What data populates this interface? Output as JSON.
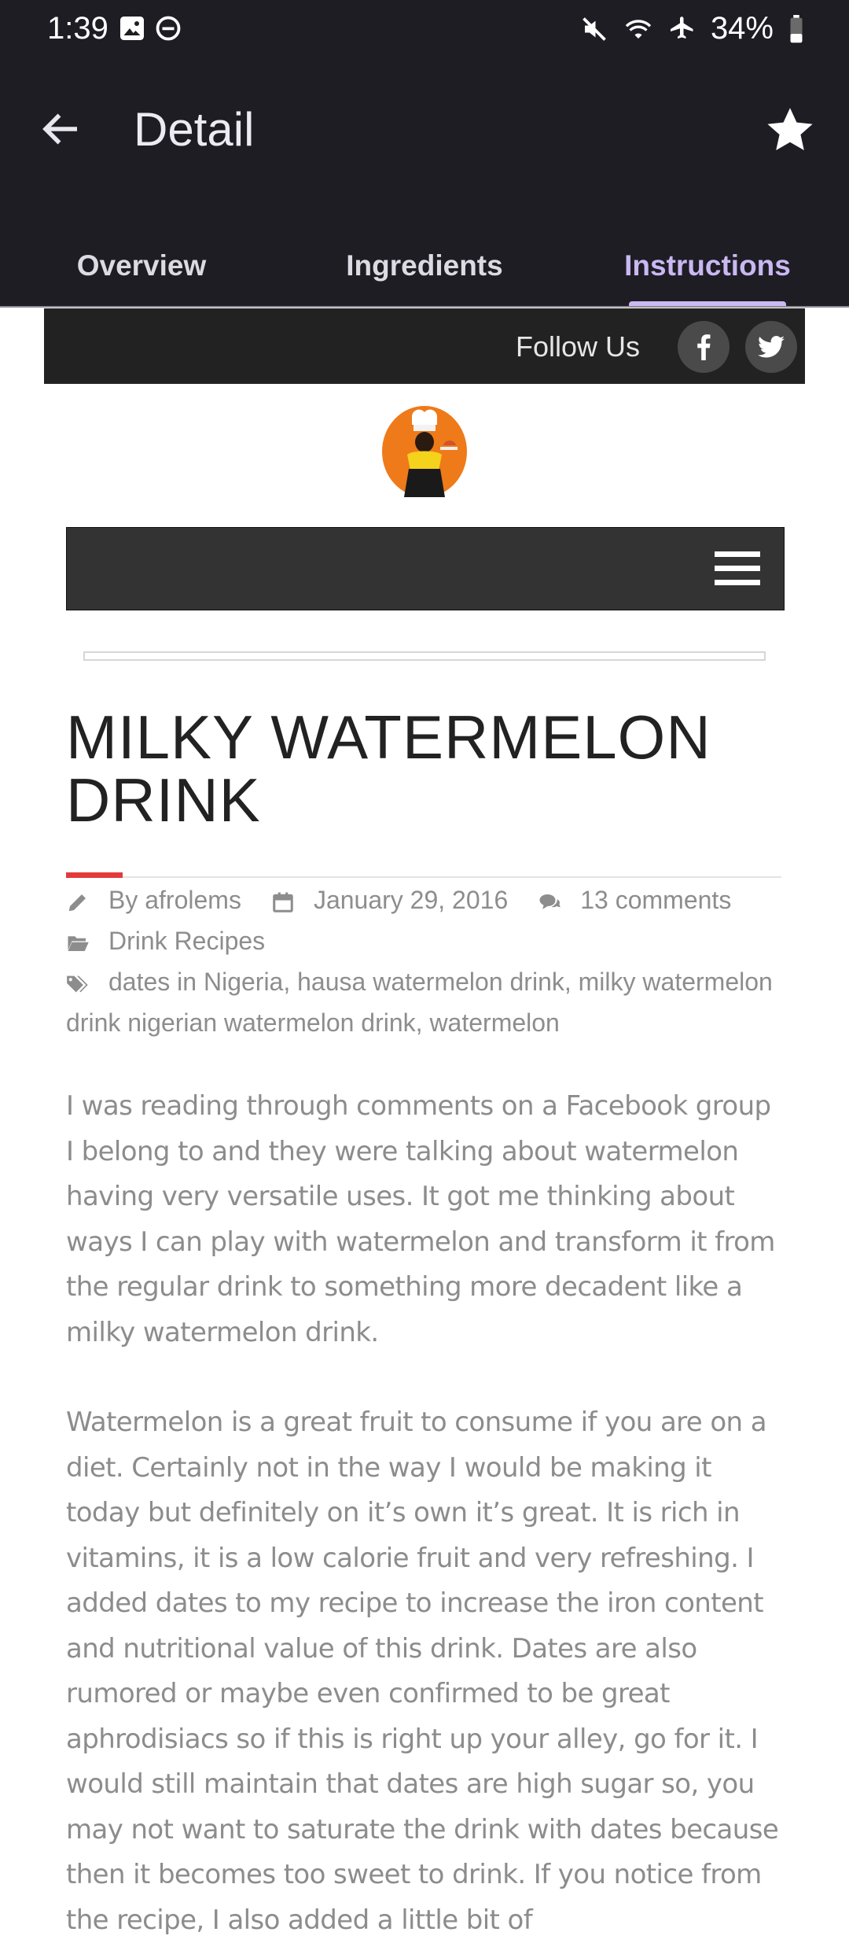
{
  "status_bar": {
    "time": "1:39",
    "battery": "34%"
  },
  "toolbar": {
    "title": "Detail"
  },
  "tabs": [
    {
      "label": "Overview",
      "active": false
    },
    {
      "label": "Ingredients",
      "active": false
    },
    {
      "label": "Instructions",
      "active": true
    }
  ],
  "site": {
    "follow_label": "Follow Us",
    "social": [
      "facebook-icon",
      "twitter-icon"
    ]
  },
  "post": {
    "title_line1": "MILKY WATERMELON",
    "title_line2": "DRINK",
    "author": "By afrolems",
    "date": "January 29, 2016",
    "comments": "13 comments",
    "category": "Drink Recipes",
    "tags": [
      "dates in Nigeria,",
      "hausa watermelon drink,",
      "milky watermelon drink nigerian watermelon drink,",
      "watermelon"
    ],
    "paragraphs": [
      "I was reading through comments on a Facebook group I belong to and they were talking about watermelon having very versatile uses. It got me thinking about ways I can play with watermelon and transform it from the regular drink to something more decadent like a milky watermelon drink.",
      "Watermelon is a great fruit to consume if you are on a diet. Certainly not in the way I would be making it today but definitely on it’s own it’s great. It is rich in vitamins, it is a low calorie fruit and very refreshing. I added dates to my recipe to increase the iron content and nutritional value of this drink. Dates are also rumored or maybe even confirmed to be great aphrodisiacs so if this is right up your alley, go for it. I would still maintain that dates are high sugar so, you may not want to saturate the drink with dates because then it becomes too sweet to drink. If you notice from the recipe, I also added a little bit of"
    ]
  },
  "colors": {
    "appbar_bg": "#1e1d24",
    "tab_active": "#c9b8f2",
    "title_accent": "#e43a3a"
  }
}
